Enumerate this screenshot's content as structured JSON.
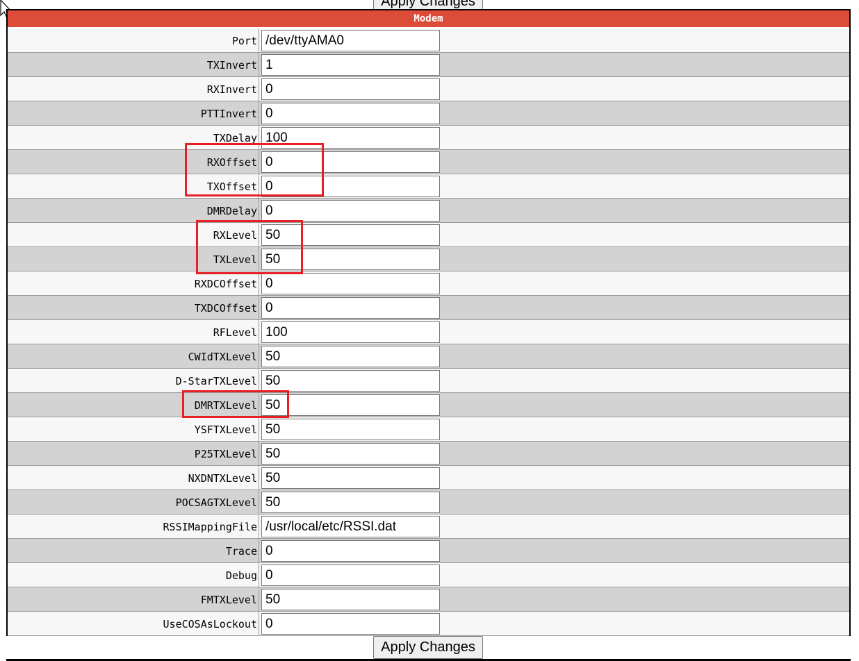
{
  "top_button_label": "Apply Changes",
  "bottom_button_label": "Apply Changes",
  "section_title": "Modem",
  "colors": {
    "header_bg": "#dd4b39",
    "highlight": "#e81f27"
  },
  "fields": [
    {
      "label": "Port",
      "value": "/dev/ttyAMA0"
    },
    {
      "label": "TXInvert",
      "value": "1"
    },
    {
      "label": "RXInvert",
      "value": "0"
    },
    {
      "label": "PTTInvert",
      "value": "0"
    },
    {
      "label": "TXDelay",
      "value": "100"
    },
    {
      "label": "RXOffset",
      "value": "0"
    },
    {
      "label": "TXOffset",
      "value": "0"
    },
    {
      "label": "DMRDelay",
      "value": "0"
    },
    {
      "label": "RXLevel",
      "value": "50"
    },
    {
      "label": "TXLevel",
      "value": "50"
    },
    {
      "label": "RXDCOffset",
      "value": "0"
    },
    {
      "label": "TXDCOffset",
      "value": "0"
    },
    {
      "label": "RFLevel",
      "value": "100"
    },
    {
      "label": "CWIdTXLevel",
      "value": "50"
    },
    {
      "label": "D-StarTXLevel",
      "value": "50"
    },
    {
      "label": "DMRTXLevel",
      "value": "50"
    },
    {
      "label": "YSFTXLevel",
      "value": "50"
    },
    {
      "label": "P25TXLevel",
      "value": "50"
    },
    {
      "label": "NXDNTXLevel",
      "value": "50"
    },
    {
      "label": "POCSAGTXLevel",
      "value": "50"
    },
    {
      "label": "RSSIMappingFile",
      "value": "/usr/local/etc/RSSI.dat"
    },
    {
      "label": "Trace",
      "value": "0"
    },
    {
      "label": "Debug",
      "value": "0"
    },
    {
      "label": "FMTXLevel",
      "value": "50"
    },
    {
      "label": "UseCOSAsLockout",
      "value": "0"
    }
  ]
}
